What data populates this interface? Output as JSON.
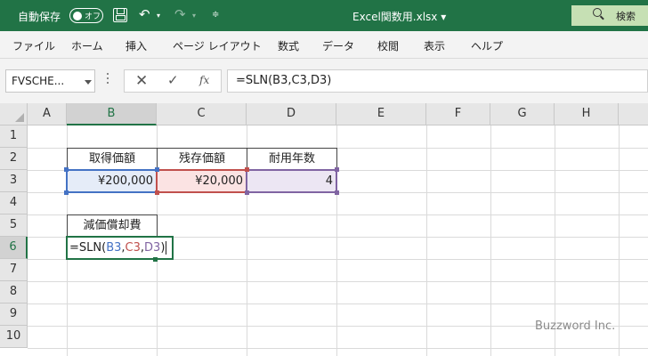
{
  "titlebar": {
    "autosave_label": "自動保存",
    "autosave_toggle": "オフ",
    "filename": "Excel関数用.xlsx",
    "search_label": "検索",
    "icons": [
      "save-icon",
      "undo-icon",
      "redo-icon",
      "customize-qat-icon",
      "search-icon"
    ]
  },
  "ribbon": {
    "tabs": [
      "ファイル",
      "ホーム",
      "挿入",
      "ページ レイアウト",
      "数式",
      "データ",
      "校閲",
      "表示",
      "ヘルプ"
    ]
  },
  "formula_bar": {
    "name_box": "FVSCHE...",
    "cancel": "✕",
    "enter": "✓",
    "fx": "fx",
    "formula": "=SLN(B3,C3,D3)"
  },
  "sheet": {
    "columns": [
      "A",
      "B",
      "C",
      "D",
      "E",
      "F",
      "G",
      "H"
    ],
    "rows": [
      "1",
      "2",
      "3",
      "4",
      "5",
      "6",
      "7",
      "8",
      "9",
      "10"
    ],
    "headers": {
      "b2": "取得価額",
      "c2": "残存価額",
      "d2": "耐用年数",
      "b5": "減価償却費"
    },
    "values": {
      "b3": "¥200,000",
      "c3": "¥20,000",
      "d3": "4"
    },
    "edit": {
      "prefix": "=SLN(",
      "b": "B3",
      "sep1": ",",
      "c": "C3",
      "sep2": ",",
      "d": "D3",
      "suffix": ")"
    },
    "colors": {
      "ref_b": "#4472c4",
      "ref_c": "#c0504d",
      "ref_d": "#8064a2",
      "accent": "#217346"
    }
  },
  "watermark": "Buzzword Inc."
}
